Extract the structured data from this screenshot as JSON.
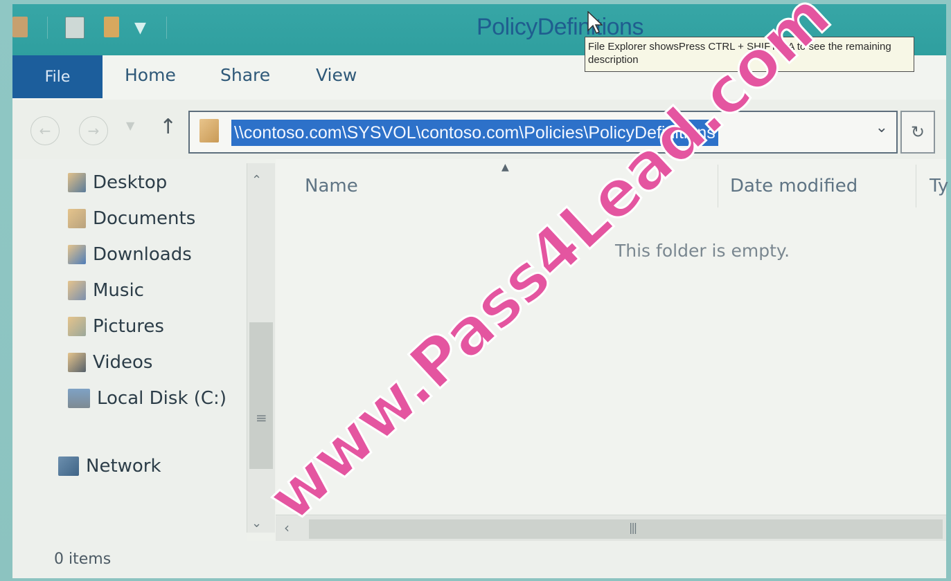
{
  "window": {
    "title": "PolicyDefinitions"
  },
  "ribbon": {
    "tabs": [
      {
        "label": "File"
      },
      {
        "label": "Home"
      },
      {
        "label": "Share"
      },
      {
        "label": "View"
      }
    ]
  },
  "navigation": {
    "address": "\\\\contoso.com\\SYSVOL\\contoso.com\\Policies\\PolicyDefinitions",
    "back_icon": "back-arrow",
    "forward_icon": "forward-arrow",
    "up_icon": "up-arrow",
    "refresh_icon": "refresh"
  },
  "sidebar": {
    "items": [
      {
        "label": "Desktop",
        "icon": "desktop-folder"
      },
      {
        "label": "Documents",
        "icon": "documents-folder"
      },
      {
        "label": "Downloads",
        "icon": "downloads-folder"
      },
      {
        "label": "Music",
        "icon": "music-folder"
      },
      {
        "label": "Pictures",
        "icon": "pictures-folder"
      },
      {
        "label": "Videos",
        "icon": "videos-folder"
      },
      {
        "label": "Local Disk (C:)",
        "icon": "drive"
      }
    ],
    "network": {
      "label": "Network",
      "icon": "network"
    }
  },
  "content": {
    "columns": [
      {
        "label": "Name"
      },
      {
        "label": "Date modified"
      },
      {
        "label": "Ty"
      }
    ],
    "empty_message": "This folder is empty."
  },
  "status": {
    "items": "0 items"
  },
  "tooltip": {
    "text": "File Explorer showsPress CTRL + SHIFT + A to see the remaining description"
  },
  "watermark": {
    "text": "www.Pass4Lead.com"
  },
  "colors": {
    "title_bar": "#2f9f9f",
    "file_tab": "#1c5e9c",
    "address_highlight": "#2d71c9",
    "watermark": "#e455a0"
  }
}
